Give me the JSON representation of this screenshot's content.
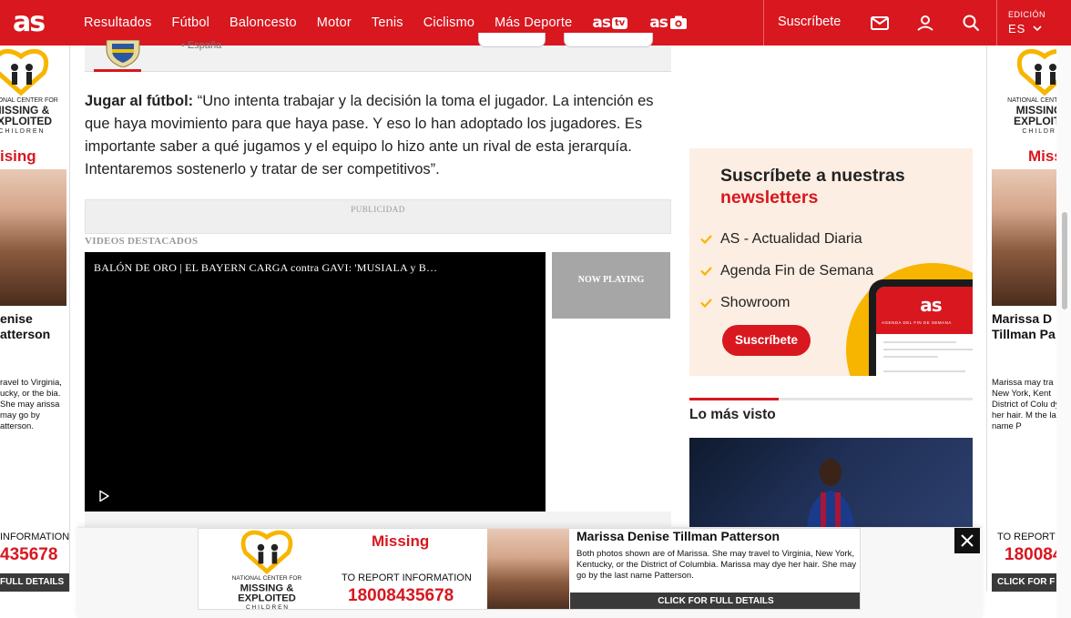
{
  "header": {
    "logo": "as",
    "nav": [
      "Resultados",
      "Fútbol",
      "Baloncesto",
      "Motor",
      "Tenis",
      "Ciclismo",
      "Más Deporte"
    ],
    "brand_tv": "as",
    "brand_tv_badge": "tv",
    "brand_photo": "as",
    "subscribe": "Suscríbete",
    "edition_label": "EDICIÓN",
    "edition_value": "ES"
  },
  "team_card": {
    "country": "• España"
  },
  "article": {
    "lead": "Jugar al fútbol:",
    "body": " “Uno intenta trabajar y la decisión la toma el jugador. La intención es que haya movimiento para que haya pase. Y eso lo han adoptado los jugadores. Es importante saber a qué jugamos y el equipo lo hizo ante un rival de esta jerarquía. Intentaremos sostenerlo y tratar de ser competitivos”."
  },
  "ad_label": "PUBLICIDAD",
  "videos": {
    "section_title": "VIDEOS DESTACADOS",
    "current_title": "BALÓN DE ORO | EL BAYERN CARGA contra GAVI: 'MUSIALA y B…",
    "now_playing": "NOW PLAYING"
  },
  "newsletter": {
    "title_line1": "Suscríbete a nuestras",
    "title_line2": "newsletters",
    "items": [
      "AS - Actualidad Diaria",
      "Agenda Fin de Semana",
      "Showroom"
    ],
    "button": "Suscríbete",
    "phone_logo": "as",
    "phone_caption": "AGENDA DEL FIN DE SEMANA"
  },
  "most_viewed": {
    "title": "Lo más visto"
  },
  "missing_ad": {
    "org_line1": "NATIONAL CENTER FOR",
    "org_line2": "MISSING &",
    "org_line3": "EXPLOITED",
    "org_line4": "CHILDREN",
    "missing": "Missing",
    "name_line1": "Marissa Denise",
    "name_line2": "Tillman Patterson",
    "full_name": "Marissa Denise Tillman Patterson",
    "desc": "Both photos shown are of Marissa.  She may travel to Virginia, New York, Kentucky, or the District of Columbia. Marissa may dye her hair. She may go by the last name Patterson.",
    "report": "TO REPORT INFORMATION",
    "phone": "18008435678",
    "cta": "CLICK FOR FULL DETAILS"
  },
  "left_ad": {
    "missing": "ising",
    "name_line1": "enise",
    "name_line2": "atterson",
    "desc": "ravel to Virginia, ucky, or the bia. She may arissa may go by atterson.",
    "report": " INFORMATION",
    "phone": "435678",
    "cta": "FULL DETAILS"
  },
  "right_ad": {
    "missing": "Miss",
    "name_line1": "Marissa D",
    "name_line2": "Tillman Pa",
    "desc": "Marissa may tra New York, Kent District of Colu dye her hair. M the last name P",
    "report": "TO REPORT",
    "phone": "180084",
    "cta": "CLICK FOR F"
  },
  "colors": {
    "brand_red": "#d8171f",
    "newsletter_bg": "#fdeee3",
    "accent_yellow": "#f7b500"
  }
}
